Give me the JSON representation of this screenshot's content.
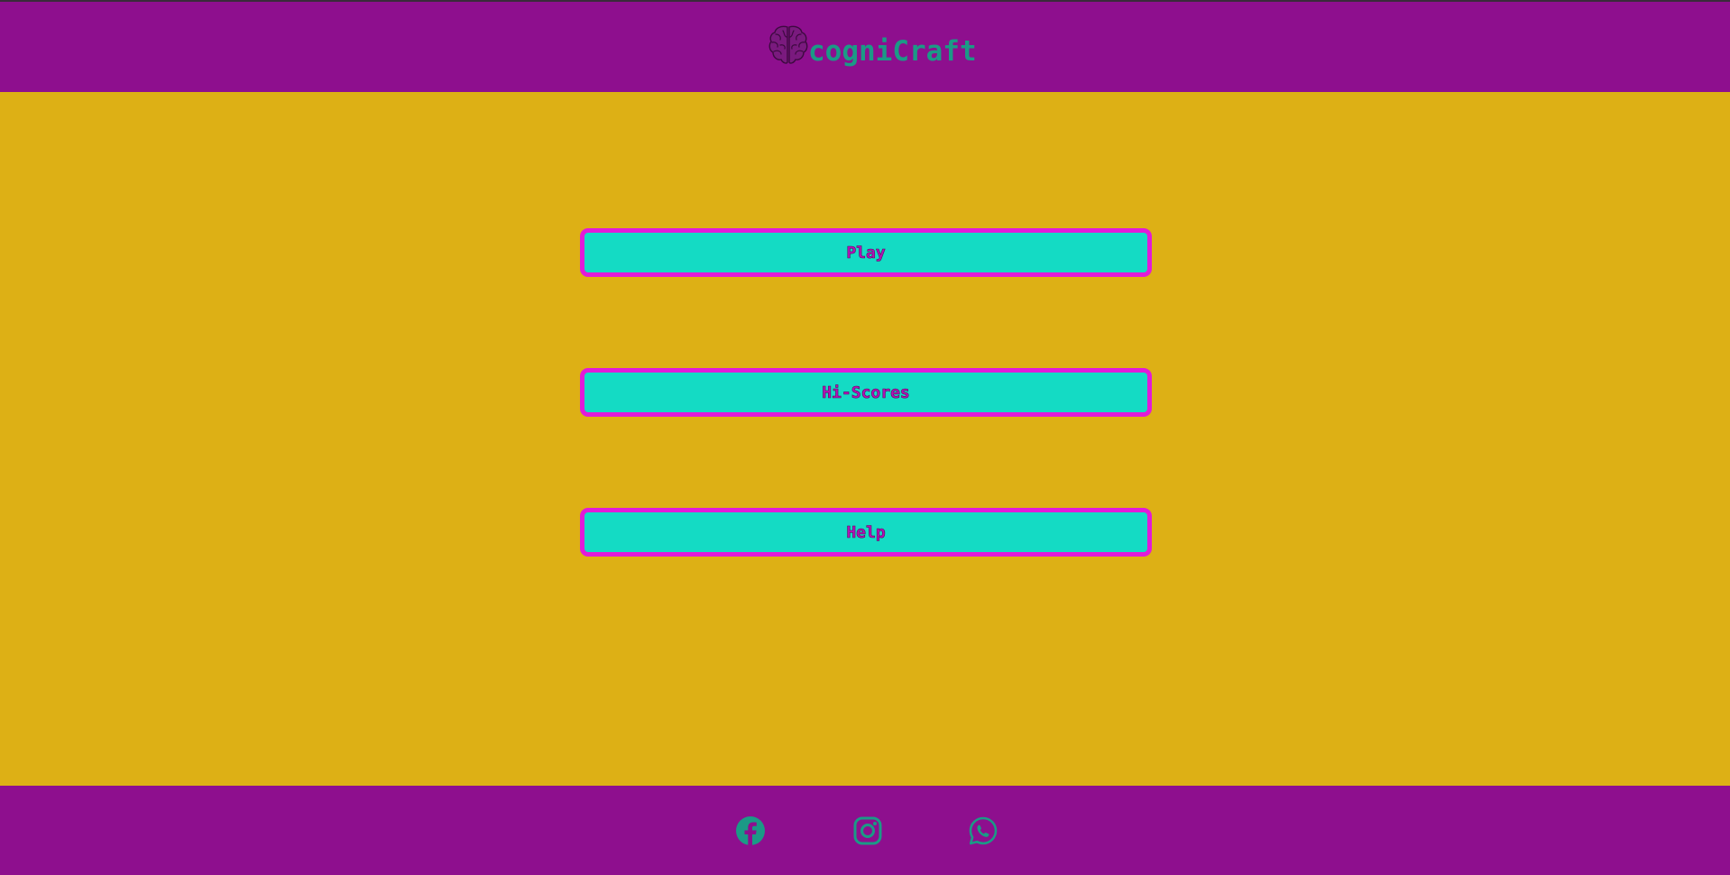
{
  "header": {
    "brand_name": "cogniCraft",
    "brand_icon": "brain-icon"
  },
  "menu": {
    "items": [
      {
        "label": "Play"
      },
      {
        "label": "Hi-Scores"
      },
      {
        "label": "Help"
      }
    ]
  },
  "footer": {
    "social": [
      {
        "icon": "facebook-icon"
      },
      {
        "icon": "instagram-icon"
      },
      {
        "icon": "whatsapp-icon"
      }
    ]
  },
  "colors": {
    "header_bg": "#8e0f8e",
    "page_bg": "#ddb015",
    "button_bg": "#14dbc4",
    "button_border": "#e11bd9",
    "button_text": "#b512b8",
    "brand_text": "#1b9a86",
    "icon_color": "#1b9a86"
  }
}
